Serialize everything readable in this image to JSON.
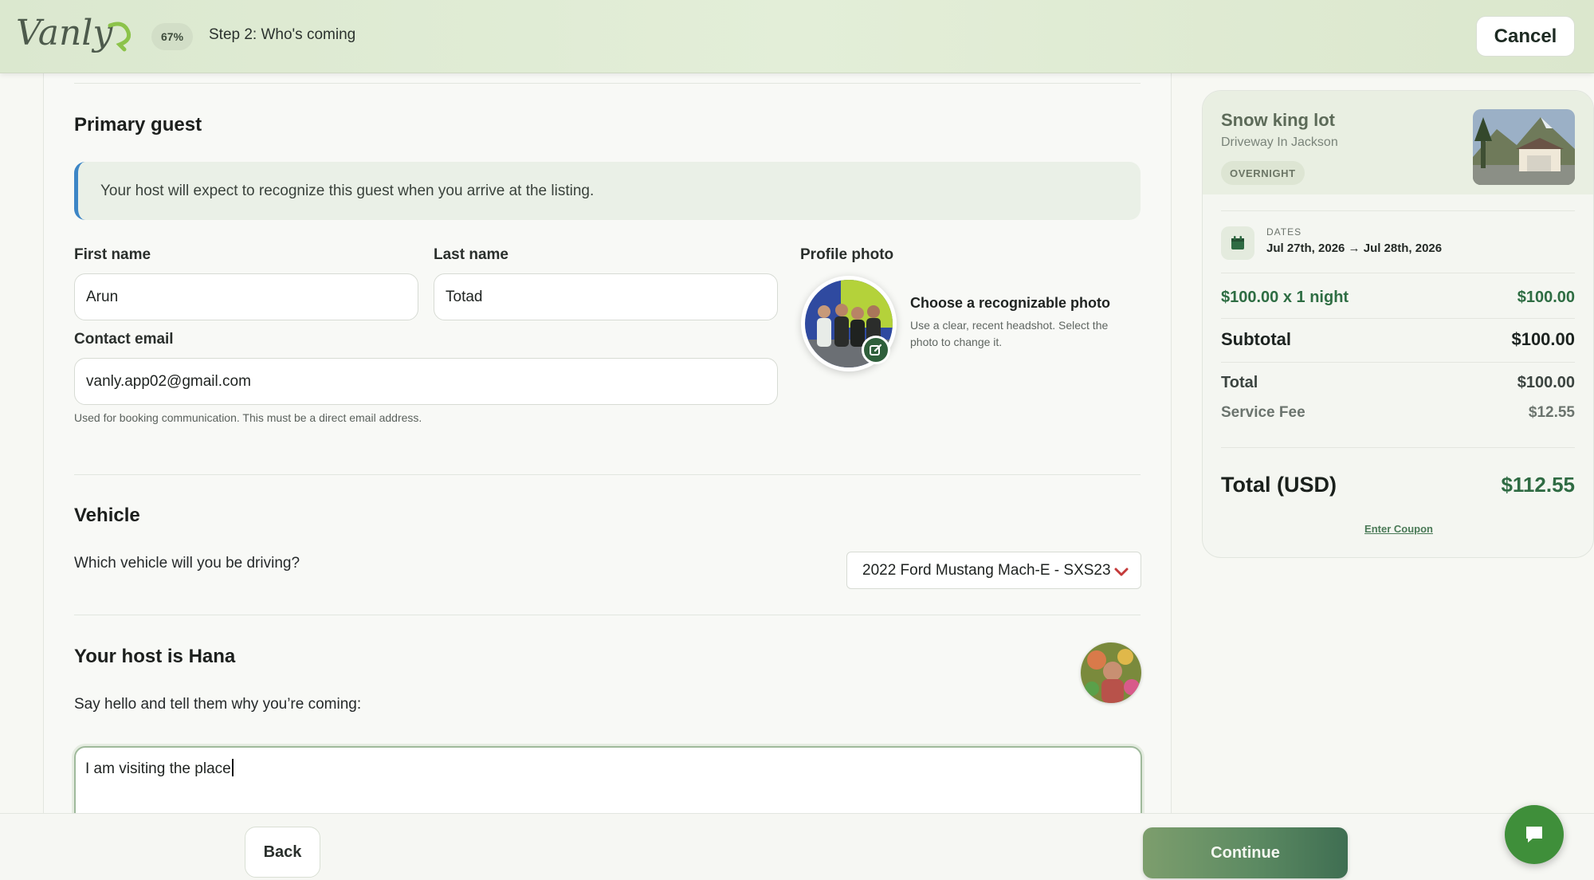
{
  "header": {
    "logo_text": "Vanly",
    "progress": "67%",
    "step_title": "Step 2: Who's coming",
    "cancel_label": "Cancel"
  },
  "primary_guest": {
    "title": "Primary guest",
    "notice": "Your host will expect to recognize this guest when you arrive at the listing.",
    "first_name_label": "First name",
    "first_name_value": "Arun",
    "last_name_label": "Last name",
    "last_name_value": "Totad",
    "email_label": "Contact email",
    "email_value": "vanly.app02@gmail.com",
    "email_help": "Used for booking communication. This must be a direct email address.",
    "photo_label": "Profile photo",
    "photo_title": "Choose a recognizable photo",
    "photo_desc": "Use a clear, recent headshot. Select the photo to change it."
  },
  "vehicle": {
    "title": "Vehicle",
    "question": "Which vehicle will you be driving?",
    "selected": "2022 Ford Mustang Mach-E - SXS23"
  },
  "host": {
    "title": "Your host is Hana",
    "prompt": "Say hello and tell them why you’re coming:",
    "message": "I am visiting the place"
  },
  "footer": {
    "back_label": "Back",
    "continue_label": "Continue"
  },
  "summary": {
    "listing_name": "Snow king lot",
    "listing_sub": "Driveway In Jackson",
    "tag": "OVERNIGHT",
    "dates_label": "DATES",
    "dates_value": "Jul 27th, 2026 → Jul 28th, 2026",
    "line_item_label": "$100.00 x 1 night",
    "line_item_value": "$100.00",
    "subtotal_label": "Subtotal",
    "subtotal_value": "$100.00",
    "total_label": "Total",
    "total_value": "$100.00",
    "fee_label": "Service Fee",
    "fee_value": "$12.55",
    "grand_total_label": "Total (USD)",
    "grand_total_value": "$112.55",
    "coupon_label": "Enter Coupon"
  },
  "colors": {
    "brand_green": "#3f8f3a",
    "notice_accent": "#3d86c6",
    "price_green": "#2e6d43"
  },
  "icons": [
    "chevron-down-icon",
    "edit-photo-icon",
    "calendar-icon",
    "chat-icon"
  ]
}
